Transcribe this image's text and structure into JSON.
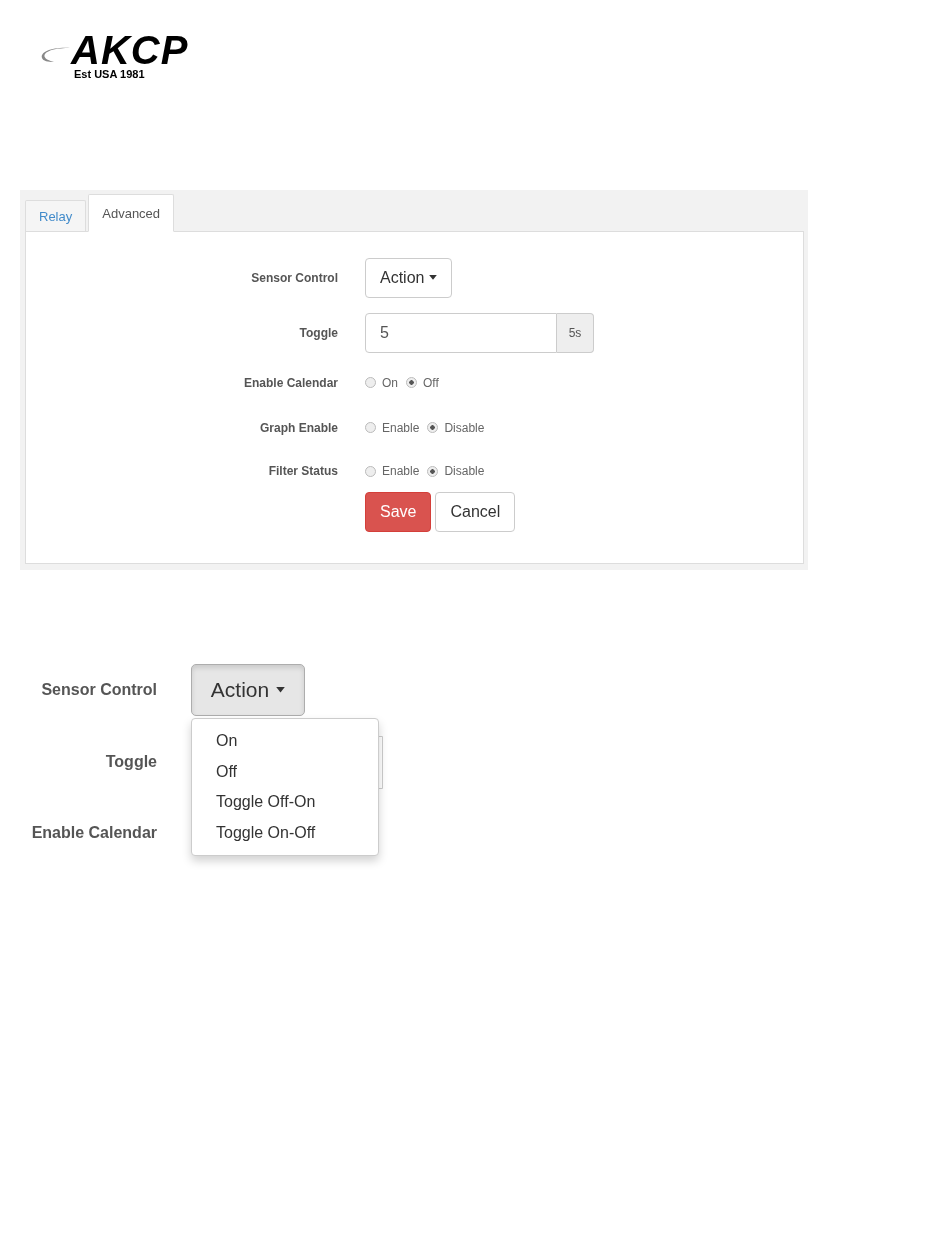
{
  "logo": {
    "name": "AKCP",
    "tagline": "Est USA 1981"
  },
  "settings_panel": {
    "tabs": [
      {
        "label": "Relay",
        "selected": false
      },
      {
        "label": "Advanced",
        "selected": true
      }
    ],
    "fields": [
      {
        "kind": "dropdown",
        "label": "Sensor Control",
        "button": "Action"
      },
      {
        "kind": "input",
        "label": "Toggle",
        "value": "5",
        "addon": "5s"
      },
      {
        "kind": "radio",
        "label": "Enable Calendar",
        "options": [
          {
            "label": "On",
            "selected": false
          },
          {
            "label": "Off",
            "selected": true
          }
        ]
      },
      {
        "kind": "radio",
        "label": "Graph Enable",
        "options": [
          {
            "label": "Enable",
            "selected": false
          },
          {
            "label": "Disable",
            "selected": true
          }
        ]
      },
      {
        "kind": "radio",
        "label": "Filter Status",
        "options": [
          {
            "label": "Enable",
            "selected": false
          },
          {
            "label": "Disable",
            "selected": true
          }
        ]
      }
    ],
    "buttons": [
      {
        "kind": "primary",
        "label": "Save"
      },
      {
        "kind": "default",
        "label": "Cancel"
      }
    ]
  },
  "dropdown_detail": {
    "labels": [
      "Sensor Control",
      "Toggle",
      "Enable Calendar"
    ],
    "button": "Action",
    "menu": [
      "On",
      "Off",
      "Toggle Off-On",
      "Toggle On-Off"
    ]
  }
}
